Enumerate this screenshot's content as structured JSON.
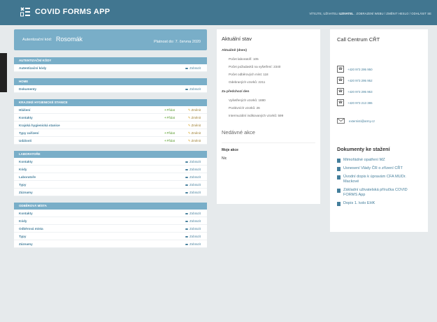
{
  "header": {
    "app_title": "COVID FORMS APP",
    "user_tools_prefix": "VÍTEJTE, UŽIVATELI",
    "user_name": "UZIVATEL",
    "user_tools_links": ". ZOBRAZENÍ WEBU / ZMĚNIT HESLO / ODHLÁSIT SE"
  },
  "auth": {
    "label": "Autentizační kód:",
    "value": "Rosomák",
    "validity": "Platnost do: 7. června 2020"
  },
  "modules": [
    {
      "title": "AUTENTIZAČNÍ KÓDY",
      "rows": [
        {
          "name": "Autentizační kódy",
          "view": "Zobrazit"
        }
      ]
    },
    {
      "title": "HOME",
      "rows": [
        {
          "name": "Dokumenty",
          "view": "Zobrazit"
        }
      ]
    },
    {
      "title": "KRAJSKÉ HYGIENICKÉ STANICE",
      "rows": [
        {
          "name": "Hlášení",
          "add": "Přidat",
          "change": "Změnit"
        },
        {
          "name": "Kontakty",
          "add": "Přidat",
          "change": "Změnit"
        },
        {
          "name": "Krajská hygienická stanice",
          "change": "Změnit"
        },
        {
          "name": "Typy zařízení",
          "add": "Přidat",
          "change": "Změnit"
        },
        {
          "name": "Události",
          "add": "Přidat",
          "change": "Změnit"
        }
      ]
    },
    {
      "title": "LABORATOŘE",
      "rows": [
        {
          "name": "Kontakty",
          "view": "Zobrazit"
        },
        {
          "name": "Kódy",
          "view": "Zobrazit"
        },
        {
          "name": "Laboratoře",
          "view": "Zobrazit"
        },
        {
          "name": "Typy",
          "view": "Zobrazit"
        },
        {
          "name": "Záznamy",
          "view": "Zobrazit"
        }
      ]
    },
    {
      "title": "ODBĚROVÁ MÍSTA",
      "rows": [
        {
          "name": "Kontakty",
          "view": "Zobrazit"
        },
        {
          "name": "Kódy",
          "view": "Zobrazit"
        },
        {
          "name": "Odběrová místa",
          "view": "Zobrazit"
        },
        {
          "name": "Typy",
          "view": "Zobrazit"
        },
        {
          "name": "Záznamy",
          "view": "Zobrazit"
        }
      ]
    }
  ],
  "status": {
    "title": "Aktuální stav",
    "today_heading": "Aktuálně (dnes)",
    "today": [
      "Počet laboratoří: 105",
      "Počet požadavků na vyšetření: 2340",
      "Počet odběrových míst: 118",
      "Odebraných vzorků: 2211"
    ],
    "prev_heading": "Za předchozí den",
    "prev": [
      "Vyšetřených vzorků: 1880",
      "Pozitivních vzorků: 26",
      "Intermuzální indikovaných vzorků: 599"
    ],
    "recent_title": "Nedávné akce",
    "my_actions": "Moje akce",
    "none": "Nic"
  },
  "callcentre": {
    "title": "Call Centrum CŘT",
    "phones": [
      "+420 973 295 950",
      "+420 973 295 952",
      "+420 973 295 953",
      "+420 973 213 386"
    ],
    "email": "externisti@army.cz",
    "docs_title": "Dokumenty ke stažení",
    "docs": [
      "Mimořádné opatření MZ",
      "Usnesení Vlády ČR o zřízení CŘT",
      "Úvodní dopis k úpravám CFA MUDr. Mackové",
      "Základní uživatelská příručka COVID FORMS App",
      "Dopis 1. kolo EHK"
    ]
  },
  "colors": {
    "header": "#417690",
    "module_head": "#79aec8",
    "link": "#447e9b",
    "add": "#5a9a2f",
    "change": "#9a7a2a"
  }
}
